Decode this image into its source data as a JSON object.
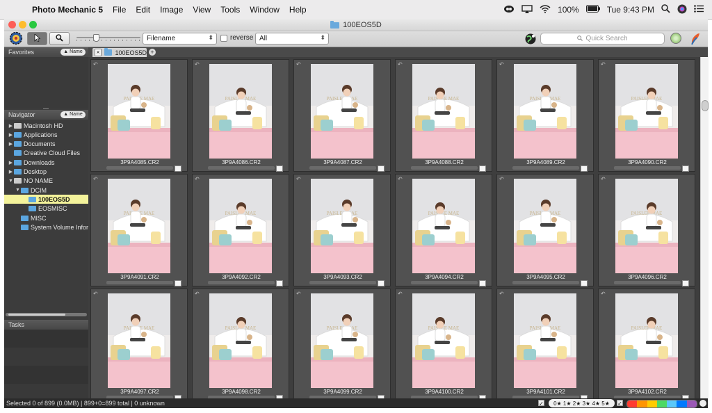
{
  "menubar": {
    "app_name": "Photo Mechanic 5",
    "items": [
      "File",
      "Edit",
      "Image",
      "View",
      "Tools",
      "Window",
      "Help"
    ],
    "battery": "100%",
    "clock": "Tue 9:43 PM"
  },
  "window": {
    "title": "100EOS5D"
  },
  "toolbar": {
    "sort_field": "Filename",
    "reverse_label": "reverse",
    "filter_value": "All",
    "search_placeholder": "Quick Search"
  },
  "sidebar": {
    "favorites_label": "Favorites",
    "favorites_sort": "Name",
    "navigator_label": "Navigator",
    "navigator_sort": "Name",
    "tree": [
      {
        "label": "Macintosh HD",
        "expander": "▶",
        "kind": "disk"
      },
      {
        "label": "Applications",
        "expander": "▶",
        "kind": "folder"
      },
      {
        "label": "Documents",
        "expander": "▶",
        "kind": "folder"
      },
      {
        "label": "Creative Cloud Files",
        "expander": "",
        "kind": "folder"
      },
      {
        "label": "Downloads",
        "expander": "▶",
        "kind": "folder"
      },
      {
        "label": "Desktop",
        "expander": "▶",
        "kind": "folder"
      },
      {
        "label": "NO NAME",
        "expander": "▼",
        "kind": "disk"
      },
      {
        "label": "DCIM",
        "expander": "▼",
        "kind": "folder"
      },
      {
        "label": "100EOS5D",
        "expander": "",
        "kind": "folder",
        "selected": true
      },
      {
        "label": "EOSMISC",
        "expander": "",
        "kind": "folder"
      },
      {
        "label": "MISC",
        "expander": "",
        "kind": "folder"
      },
      {
        "label": "System Volume Infor",
        "expander": "",
        "kind": "folder"
      }
    ],
    "tasks_label": "Tasks"
  },
  "tab": {
    "label": "100EOS5D"
  },
  "thumbnails": [
    {
      "filename": "3P9A4085.CR2"
    },
    {
      "filename": "3P9A4086.CR2"
    },
    {
      "filename": "3P9A4087.CR2"
    },
    {
      "filename": "3P9A4088.CR2"
    },
    {
      "filename": "3P9A4089.CR2"
    },
    {
      "filename": "3P9A4090.CR2"
    },
    {
      "filename": "3P9A4091.CR2"
    },
    {
      "filename": "3P9A4092.CR2"
    },
    {
      "filename": "3P9A4093.CR2"
    },
    {
      "filename": "3P9A4094.CR2"
    },
    {
      "filename": "3P9A4095.CR2"
    },
    {
      "filename": "3P9A4096.CR2"
    },
    {
      "filename": "3P9A4097.CR2"
    },
    {
      "filename": "3P9A4098.CR2"
    },
    {
      "filename": "3P9A4099.CR2"
    },
    {
      "filename": "3P9A4100.CR2"
    },
    {
      "filename": "3P9A4101.CR2"
    },
    {
      "filename": "3P9A4102.CR2"
    }
  ],
  "photo_banner_text": "PAISLEE MAE",
  "statusbar": {
    "summary": "Selected 0 of 899 (0.0MB) | 899+0=899 total | 0 unknown",
    "star_filter": "0★ 1★ 2★ 3★ 4★ 5★"
  },
  "colors": {
    "selection": "#f4f39b",
    "folder": "#5ba6e0",
    "label_colors": [
      "#ff3b30",
      "#ff9500",
      "#ffcc00",
      "#4cd964",
      "#5ac8fa",
      "#007aff",
      "#9b59b6"
    ]
  }
}
